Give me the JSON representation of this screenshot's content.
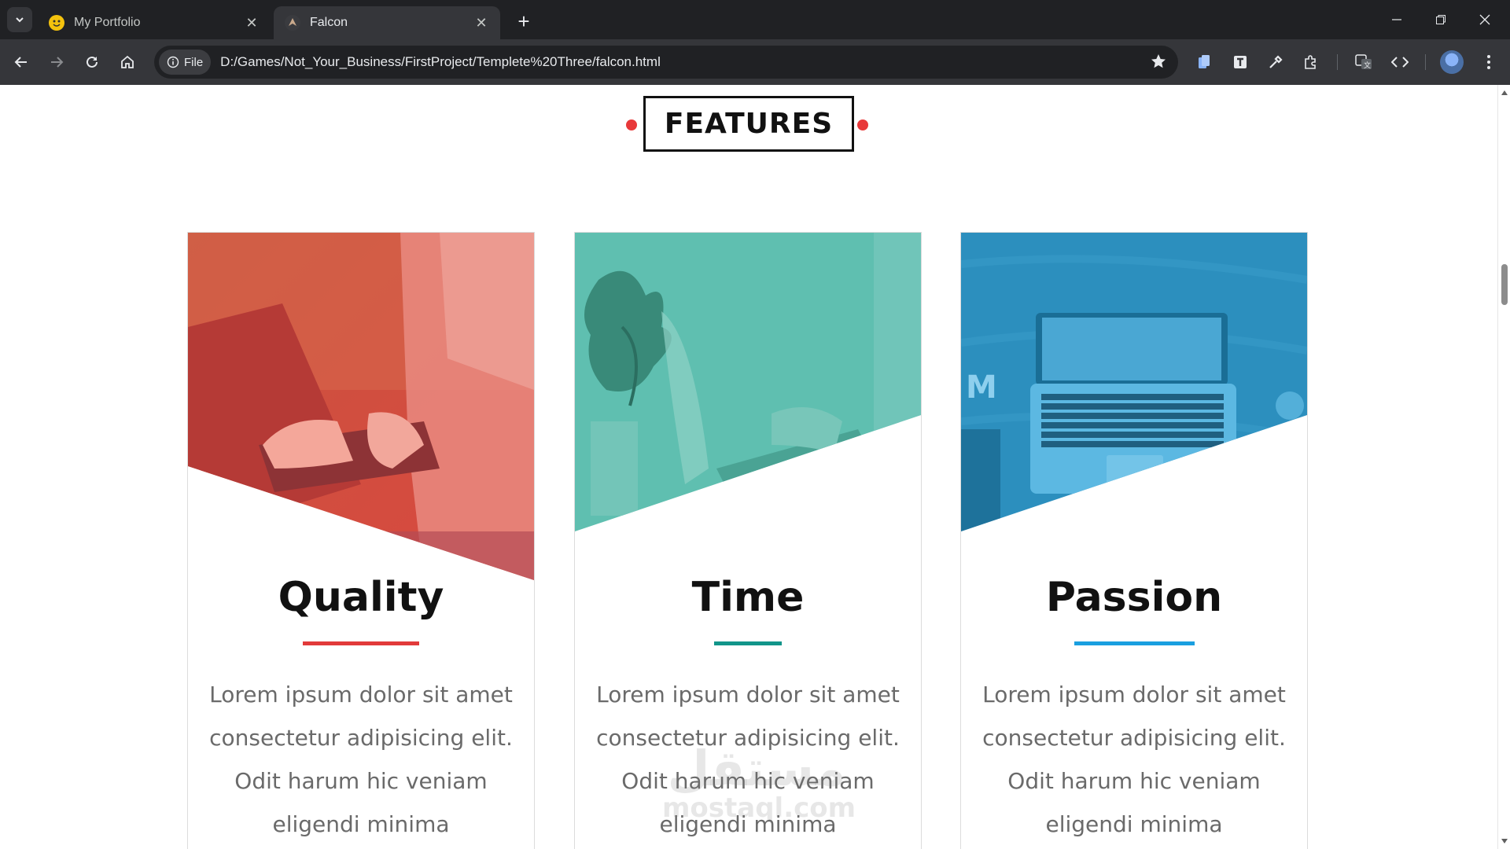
{
  "browser": {
    "tabs": [
      {
        "title": "My Portfolio",
        "favicon": "smiley-favicon-icon",
        "active": false
      },
      {
        "title": "Falcon",
        "favicon": "falcon-favicon-icon",
        "active": true
      }
    ],
    "address": {
      "chip_label": "File",
      "url": "D:/Games/Not_Your_Business/FirstProject/Templete%20Three/falcon.html"
    }
  },
  "page": {
    "section_title": "FEATURES",
    "accent_color": "#e8393a",
    "cards": [
      {
        "title": "Quality",
        "text": "Lorem ipsum dolor sit amet consectetur adipisicing elit. Odit harum hic veniam eligendi minima",
        "color": "#e23a3a"
      },
      {
        "title": "Time",
        "text": "Lorem ipsum dolor sit amet consectetur adipisicing elit. Odit harum hic veniam eligendi minima",
        "color": "#12958a"
      },
      {
        "title": "Passion",
        "text": "Lorem ipsum dolor sit amet consectetur adipisicing elit. Odit harum hic veniam eligendi minima",
        "color": "#1a9fe0"
      }
    ],
    "watermark": {
      "arabic": "مستقل",
      "latin": "mostaql.com"
    }
  }
}
